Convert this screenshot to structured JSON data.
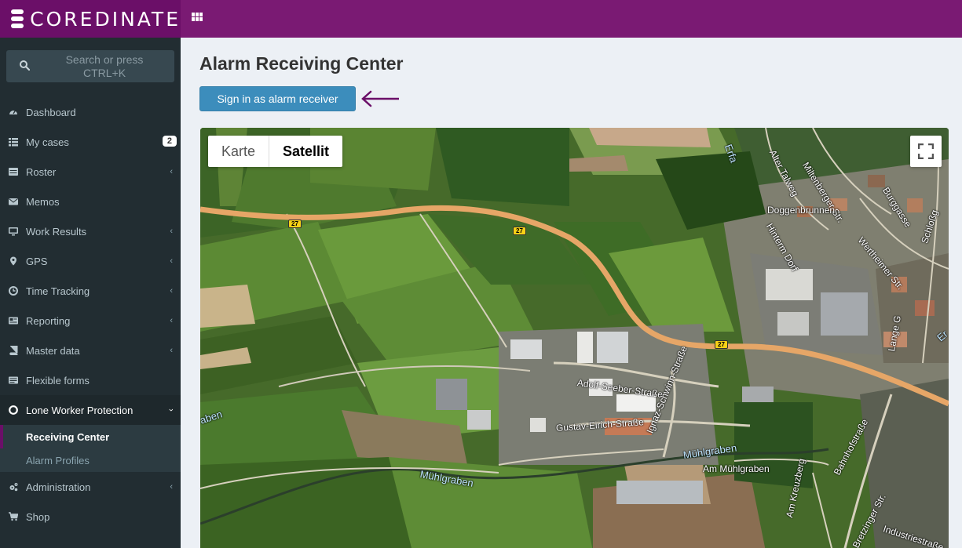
{
  "app": {
    "brand": "COREDINATE",
    "accent": "#6b0f68"
  },
  "search": {
    "placeholder": "Search or press CTRL+K"
  },
  "menu": {
    "items": [
      {
        "label": "Dashboard",
        "icon": "dashboard-icon"
      },
      {
        "label": "My cases",
        "icon": "list-icon",
        "badge": "2"
      },
      {
        "label": "Roster",
        "icon": "roster-icon"
      },
      {
        "label": "Memos",
        "icon": "envelope-icon"
      },
      {
        "label": "Work Results",
        "icon": "monitor-icon"
      },
      {
        "label": "GPS",
        "icon": "map-marker-icon"
      },
      {
        "label": "Time Tracking",
        "icon": "clock-icon"
      },
      {
        "label": "Reporting",
        "icon": "reporting-icon"
      },
      {
        "label": "Master data",
        "icon": "book-icon"
      },
      {
        "label": "Flexible forms",
        "icon": "forms-icon"
      },
      {
        "label": "Lone Worker Protection",
        "icon": "lifebuoy-icon"
      },
      {
        "label": "Administration",
        "icon": "cogs-icon"
      },
      {
        "label": "Shop",
        "icon": "cart-icon"
      }
    ],
    "submenu": [
      {
        "label": "Receiving Center"
      },
      {
        "label": "Alarm Profiles"
      }
    ]
  },
  "page": {
    "title": "Alarm Receiving Center",
    "signin_label": "Sign in as alarm receiver"
  },
  "map": {
    "type_buttons": [
      "Karte",
      "Satellit"
    ],
    "selected_type": "Satellit",
    "road_number": "27",
    "labels": {
      "erfa": "Erfa",
      "alter_talweg": "Alter Talweg",
      "miltenberger": "Miltenberger Str.",
      "burggasse": "Burggasse",
      "doggenbrunnen": "Doggenbrunnen",
      "hinterm_dorf": "Hinterm Dorf",
      "wertheimer": "Wertheimer Str.",
      "schlossg": "Schloßg",
      "adolf": "Adolf-Seeber-Straße",
      "ignaz": "Ignaz-Schwinn-Straße",
      "gustav": "Gustav-Eirich-Straße",
      "muehlgraben": "Mühlgraben",
      "muehlgraben2": "Mühlgraben",
      "am_muehlgraben": "Am Mühlgraben",
      "am_kreuzberg": "Am Kreuzberg",
      "bahnhofstrasse": "Bahnhofstraße",
      "bretzinger": "Bretzinger Str.",
      "industrie": "Industriestraße",
      "lange_g": "Lange G",
      "er": "Er",
      "aben": "aben"
    }
  }
}
